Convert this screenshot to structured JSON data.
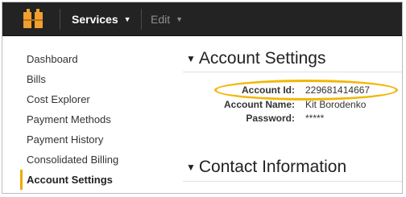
{
  "topbar": {
    "logo_icon": "aws-cube-logo-icon",
    "services_label": "Services",
    "edit_label": "Edit",
    "caret_glyph": "⌄"
  },
  "sidebar": {
    "items": [
      {
        "label": "Dashboard",
        "active": false
      },
      {
        "label": "Bills",
        "active": false
      },
      {
        "label": "Cost Explorer",
        "active": false
      },
      {
        "label": "Payment Methods",
        "active": false
      },
      {
        "label": "Payment History",
        "active": false
      },
      {
        "label": "Consolidated Billing",
        "active": false
      },
      {
        "label": "Account Settings",
        "active": true
      }
    ]
  },
  "account_settings": {
    "title": "Account Settings",
    "fields": [
      {
        "label": "Account Id:",
        "value": "229681414667"
      },
      {
        "label": "Account Name:",
        "value": "Kit Borodenko"
      },
      {
        "label": "Password:",
        "value": "*****"
      }
    ]
  },
  "contact_information": {
    "title": "Contact Information"
  },
  "colors": {
    "topbar": "#232323",
    "highlight": "#f2b705",
    "logo_orange": "#f0a030",
    "active_marker": "#f0a800"
  }
}
